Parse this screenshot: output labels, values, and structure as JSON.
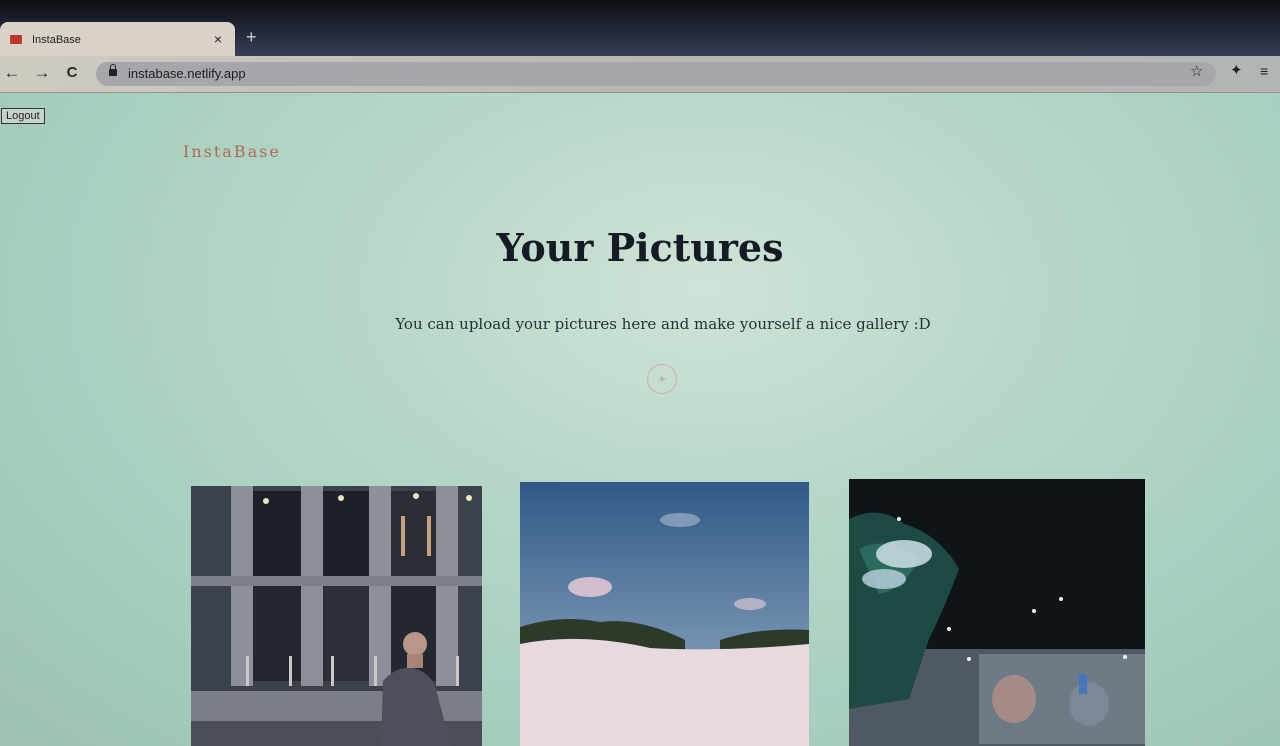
{
  "browser": {
    "tab_title": "InstaBase",
    "tab_close": "×",
    "new_tab": "+",
    "url": "instabase.netlify.app",
    "back": "←",
    "forward": "→",
    "reload": "C",
    "star": "☆",
    "extensions": "✦",
    "menu": "≡"
  },
  "header": {
    "logout_label": "Logout",
    "logo_text": "InstaBase"
  },
  "main": {
    "title": "Your Pictures",
    "subtitle": "You can upload your pictures here and make yourself a nice gallery :D",
    "add_button": "+"
  },
  "gallery": {
    "images": [
      {
        "description_icon": "building-man-photo"
      },
      {
        "description_icon": "sky-dune-photo"
      },
      {
        "description_icon": "night-tree-photo"
      }
    ]
  },
  "colors": {
    "logo": "#b06a58",
    "title": "#141b24",
    "accent_plus": "#d08c8c"
  }
}
